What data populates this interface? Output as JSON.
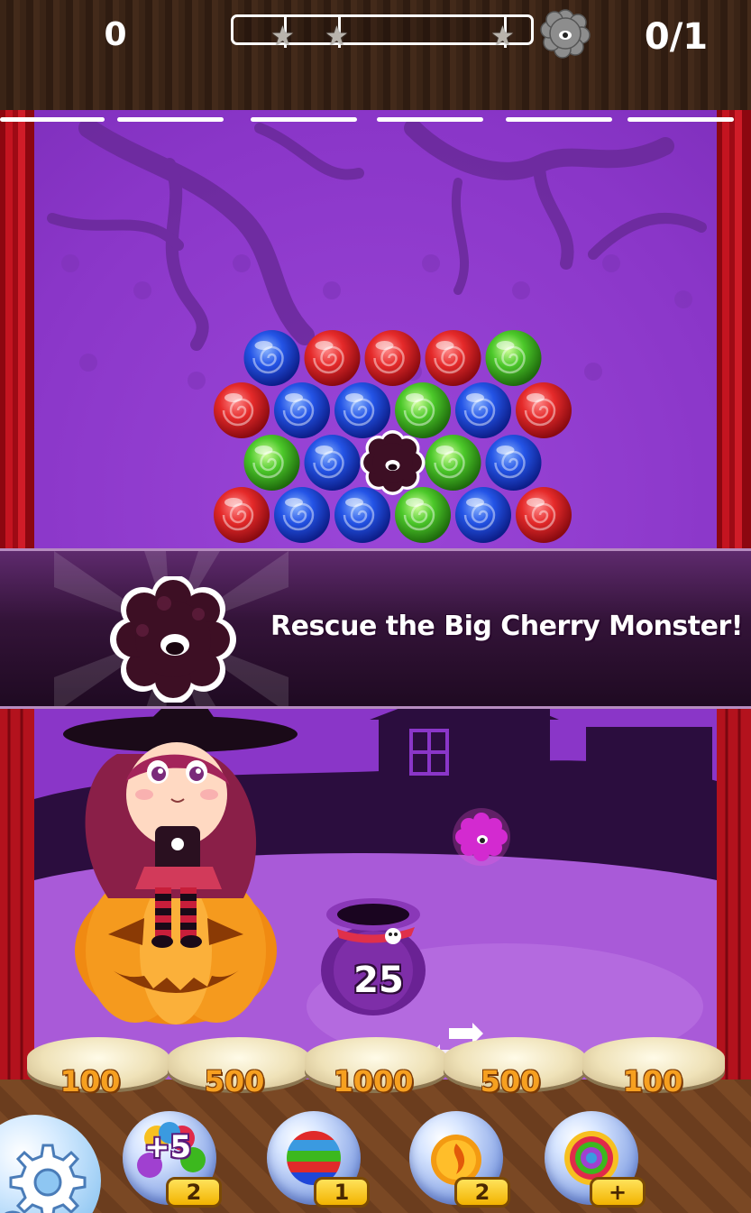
{
  "hud": {
    "score": "0",
    "goal_progress": "0/1",
    "goal_icon": "cherry-monster-icon",
    "star_progress": 0,
    "stars": 3
  },
  "banner": {
    "message": "Rescue the Big Cherry Monster!",
    "icon": "cherry-monster-icon"
  },
  "board": {
    "rows": [
      [
        "blue",
        "red",
        "red",
        "red",
        "green"
      ],
      [
        "red",
        "blue",
        "blue",
        "green",
        "blue",
        "red"
      ],
      [
        "green",
        "blue",
        "monster",
        "green",
        "blue"
      ],
      [
        "red",
        "blue",
        "blue",
        "green",
        "blue",
        "red"
      ]
    ]
  },
  "pot": {
    "shots_left": "25"
  },
  "score_pads": [
    "100",
    "500",
    "1000",
    "500",
    "100"
  ],
  "boosters": [
    {
      "name": "plus-five-booster",
      "icon": "candy-plus-five-icon",
      "label": "+5",
      "count": "2"
    },
    {
      "name": "rainbow-ball-booster",
      "icon": "striped-ball-icon",
      "count": "1"
    },
    {
      "name": "fire-ball-booster",
      "icon": "fireball-icon",
      "count": "2"
    },
    {
      "name": "swirl-ball-booster",
      "icon": "rainbow-swirl-icon",
      "count": "+"
    }
  ],
  "settings": {
    "icon": "gear-icon"
  },
  "colors": {
    "red": "#e0202a",
    "blue": "#1f46d8",
    "green": "#3cb81e",
    "purple": "#8a36c8",
    "monster": "#3d0f24"
  }
}
